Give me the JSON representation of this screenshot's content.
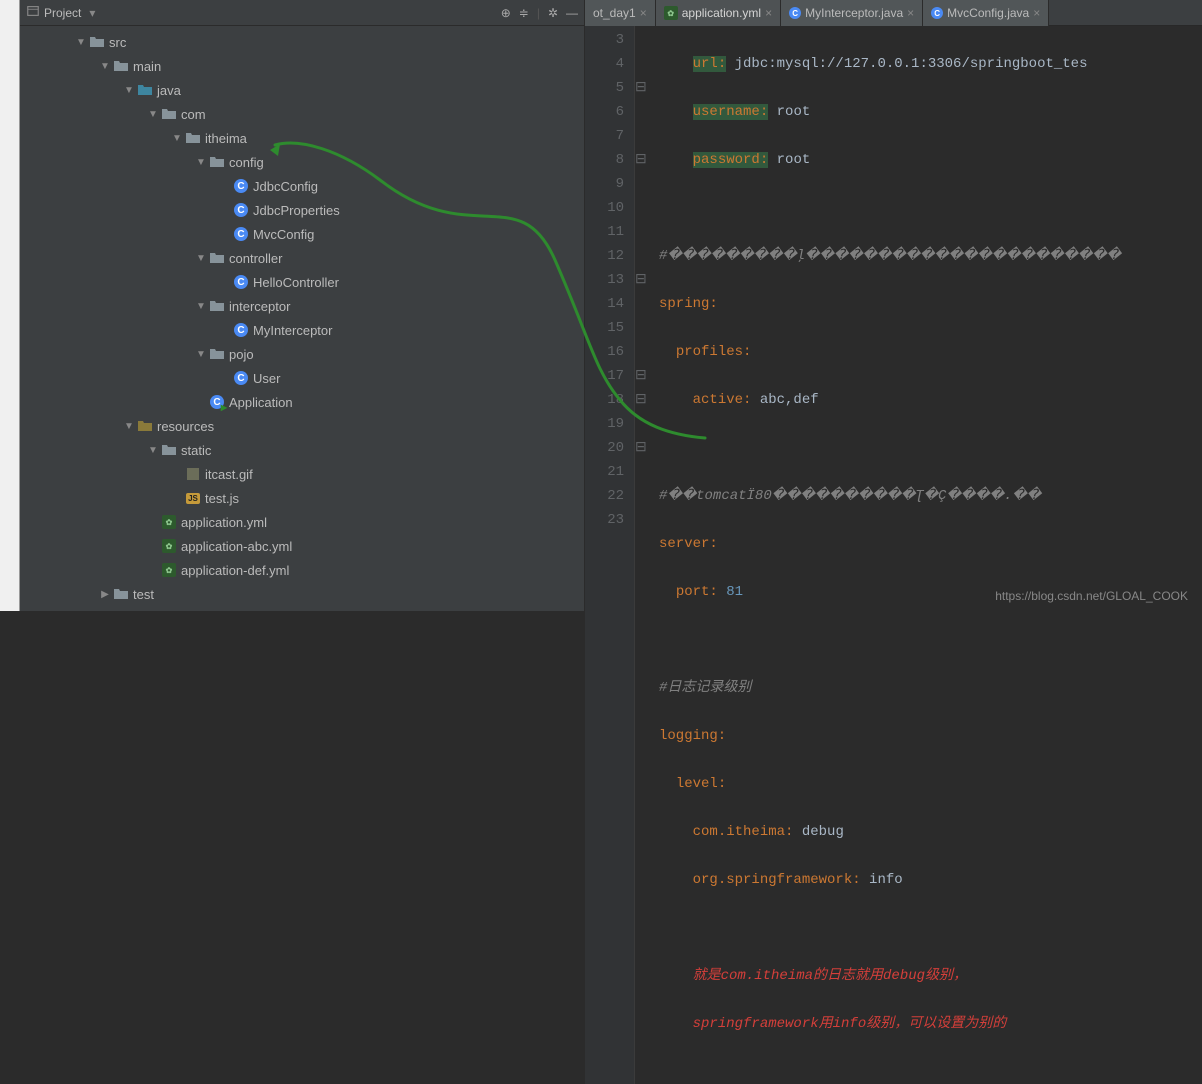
{
  "panel": {
    "title": "Project"
  },
  "tree": {
    "src": "src",
    "main": "main",
    "java": "java",
    "com": "com",
    "itheima": "itheima",
    "config": "config",
    "jdbcConfig": "JdbcConfig",
    "jdbcProperties": "JdbcProperties",
    "mvcConfig": "MvcConfig",
    "controller": "controller",
    "helloController": "HelloController",
    "interceptor": "interceptor",
    "myInterceptor": "MyInterceptor",
    "pojo": "pojo",
    "user": "User",
    "application": "Application",
    "resources": "resources",
    "static": "static",
    "itcast_gif": "itcast.gif",
    "test_js": "test.js",
    "app_yml": "application.yml",
    "app_abc_yml": "application-abc.yml",
    "app_def_yml": "application-def.yml",
    "test": "test"
  },
  "tabs": {
    "t0": "ot_day1",
    "t1": "application.yml",
    "t2": "MyInterceptor.java",
    "t3": "MvcConfig.java"
  },
  "gutter": [
    "3",
    "4",
    "5",
    "6",
    "7",
    "8",
    "9",
    "10",
    "11",
    "12",
    "13",
    "14",
    "15",
    "16",
    "17",
    "18",
    "19",
    "20",
    "21",
    "22",
    "23"
  ],
  "code": {
    "l3_key": "url:",
    "l3_val": " jdbc:mysql://127.0.0.1:3306/springboot_tes",
    "l4_key": "username:",
    "l4_val": " root",
    "l5_key": "password:",
    "l5_val": " root",
    "l7": "#���������ļ����������������������",
    "l8": "spring:",
    "l9": "profiles:",
    "l10_key": "active:",
    "l10_val": " abc,def",
    "l12": "#��tomcatÏ80����������Ʈ�Ç����.��",
    "l13": "server:",
    "l14_key": "port:",
    "l14_val": " 81",
    "l16": "#日志记录级别",
    "l17": "logging:",
    "l18": "level:",
    "l19_key": "com.itheima:",
    "l19_val": " debug",
    "l20_key": "org.springframework:",
    "l20_val": " info",
    "l22": "就是com.itheima的日志就用debug级别，",
    "l23": "springframework用info级别，可以设置为别的"
  },
  "watermark": "https://blog.csdn.net/GLOAL_COOK"
}
